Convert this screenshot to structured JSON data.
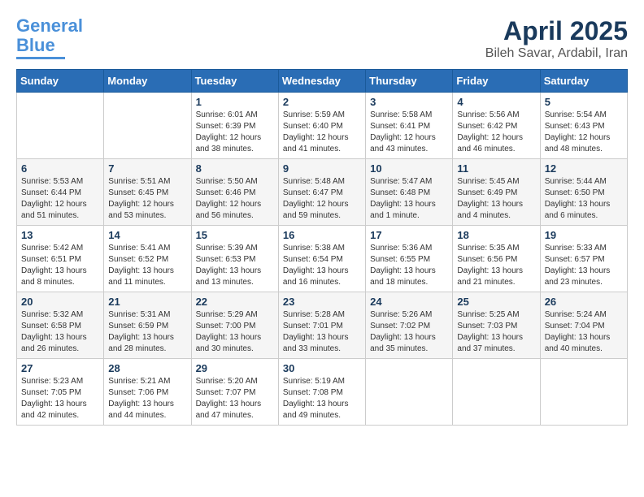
{
  "logo": {
    "line1": "General",
    "line2": "Blue"
  },
  "title": "April 2025",
  "location": "Bileh Savar, Ardabil, Iran",
  "weekdays": [
    "Sunday",
    "Monday",
    "Tuesday",
    "Wednesday",
    "Thursday",
    "Friday",
    "Saturday"
  ],
  "weeks": [
    [
      {
        "day": "",
        "info": ""
      },
      {
        "day": "",
        "info": ""
      },
      {
        "day": "1",
        "info": "Sunrise: 6:01 AM\nSunset: 6:39 PM\nDaylight: 12 hours\nand 38 minutes."
      },
      {
        "day": "2",
        "info": "Sunrise: 5:59 AM\nSunset: 6:40 PM\nDaylight: 12 hours\nand 41 minutes."
      },
      {
        "day": "3",
        "info": "Sunrise: 5:58 AM\nSunset: 6:41 PM\nDaylight: 12 hours\nand 43 minutes."
      },
      {
        "day": "4",
        "info": "Sunrise: 5:56 AM\nSunset: 6:42 PM\nDaylight: 12 hours\nand 46 minutes."
      },
      {
        "day": "5",
        "info": "Sunrise: 5:54 AM\nSunset: 6:43 PM\nDaylight: 12 hours\nand 48 minutes."
      }
    ],
    [
      {
        "day": "6",
        "info": "Sunrise: 5:53 AM\nSunset: 6:44 PM\nDaylight: 12 hours\nand 51 minutes."
      },
      {
        "day": "7",
        "info": "Sunrise: 5:51 AM\nSunset: 6:45 PM\nDaylight: 12 hours\nand 53 minutes."
      },
      {
        "day": "8",
        "info": "Sunrise: 5:50 AM\nSunset: 6:46 PM\nDaylight: 12 hours\nand 56 minutes."
      },
      {
        "day": "9",
        "info": "Sunrise: 5:48 AM\nSunset: 6:47 PM\nDaylight: 12 hours\nand 59 minutes."
      },
      {
        "day": "10",
        "info": "Sunrise: 5:47 AM\nSunset: 6:48 PM\nDaylight: 13 hours\nand 1 minute."
      },
      {
        "day": "11",
        "info": "Sunrise: 5:45 AM\nSunset: 6:49 PM\nDaylight: 13 hours\nand 4 minutes."
      },
      {
        "day": "12",
        "info": "Sunrise: 5:44 AM\nSunset: 6:50 PM\nDaylight: 13 hours\nand 6 minutes."
      }
    ],
    [
      {
        "day": "13",
        "info": "Sunrise: 5:42 AM\nSunset: 6:51 PM\nDaylight: 13 hours\nand 8 minutes."
      },
      {
        "day": "14",
        "info": "Sunrise: 5:41 AM\nSunset: 6:52 PM\nDaylight: 13 hours\nand 11 minutes."
      },
      {
        "day": "15",
        "info": "Sunrise: 5:39 AM\nSunset: 6:53 PM\nDaylight: 13 hours\nand 13 minutes."
      },
      {
        "day": "16",
        "info": "Sunrise: 5:38 AM\nSunset: 6:54 PM\nDaylight: 13 hours\nand 16 minutes."
      },
      {
        "day": "17",
        "info": "Sunrise: 5:36 AM\nSunset: 6:55 PM\nDaylight: 13 hours\nand 18 minutes."
      },
      {
        "day": "18",
        "info": "Sunrise: 5:35 AM\nSunset: 6:56 PM\nDaylight: 13 hours\nand 21 minutes."
      },
      {
        "day": "19",
        "info": "Sunrise: 5:33 AM\nSunset: 6:57 PM\nDaylight: 13 hours\nand 23 minutes."
      }
    ],
    [
      {
        "day": "20",
        "info": "Sunrise: 5:32 AM\nSunset: 6:58 PM\nDaylight: 13 hours\nand 26 minutes."
      },
      {
        "day": "21",
        "info": "Sunrise: 5:31 AM\nSunset: 6:59 PM\nDaylight: 13 hours\nand 28 minutes."
      },
      {
        "day": "22",
        "info": "Sunrise: 5:29 AM\nSunset: 7:00 PM\nDaylight: 13 hours\nand 30 minutes."
      },
      {
        "day": "23",
        "info": "Sunrise: 5:28 AM\nSunset: 7:01 PM\nDaylight: 13 hours\nand 33 minutes."
      },
      {
        "day": "24",
        "info": "Sunrise: 5:26 AM\nSunset: 7:02 PM\nDaylight: 13 hours\nand 35 minutes."
      },
      {
        "day": "25",
        "info": "Sunrise: 5:25 AM\nSunset: 7:03 PM\nDaylight: 13 hours\nand 37 minutes."
      },
      {
        "day": "26",
        "info": "Sunrise: 5:24 AM\nSunset: 7:04 PM\nDaylight: 13 hours\nand 40 minutes."
      }
    ],
    [
      {
        "day": "27",
        "info": "Sunrise: 5:23 AM\nSunset: 7:05 PM\nDaylight: 13 hours\nand 42 minutes."
      },
      {
        "day": "28",
        "info": "Sunrise: 5:21 AM\nSunset: 7:06 PM\nDaylight: 13 hours\nand 44 minutes."
      },
      {
        "day": "29",
        "info": "Sunrise: 5:20 AM\nSunset: 7:07 PM\nDaylight: 13 hours\nand 47 minutes."
      },
      {
        "day": "30",
        "info": "Sunrise: 5:19 AM\nSunset: 7:08 PM\nDaylight: 13 hours\nand 49 minutes."
      },
      {
        "day": "",
        "info": ""
      },
      {
        "day": "",
        "info": ""
      },
      {
        "day": "",
        "info": ""
      }
    ]
  ]
}
